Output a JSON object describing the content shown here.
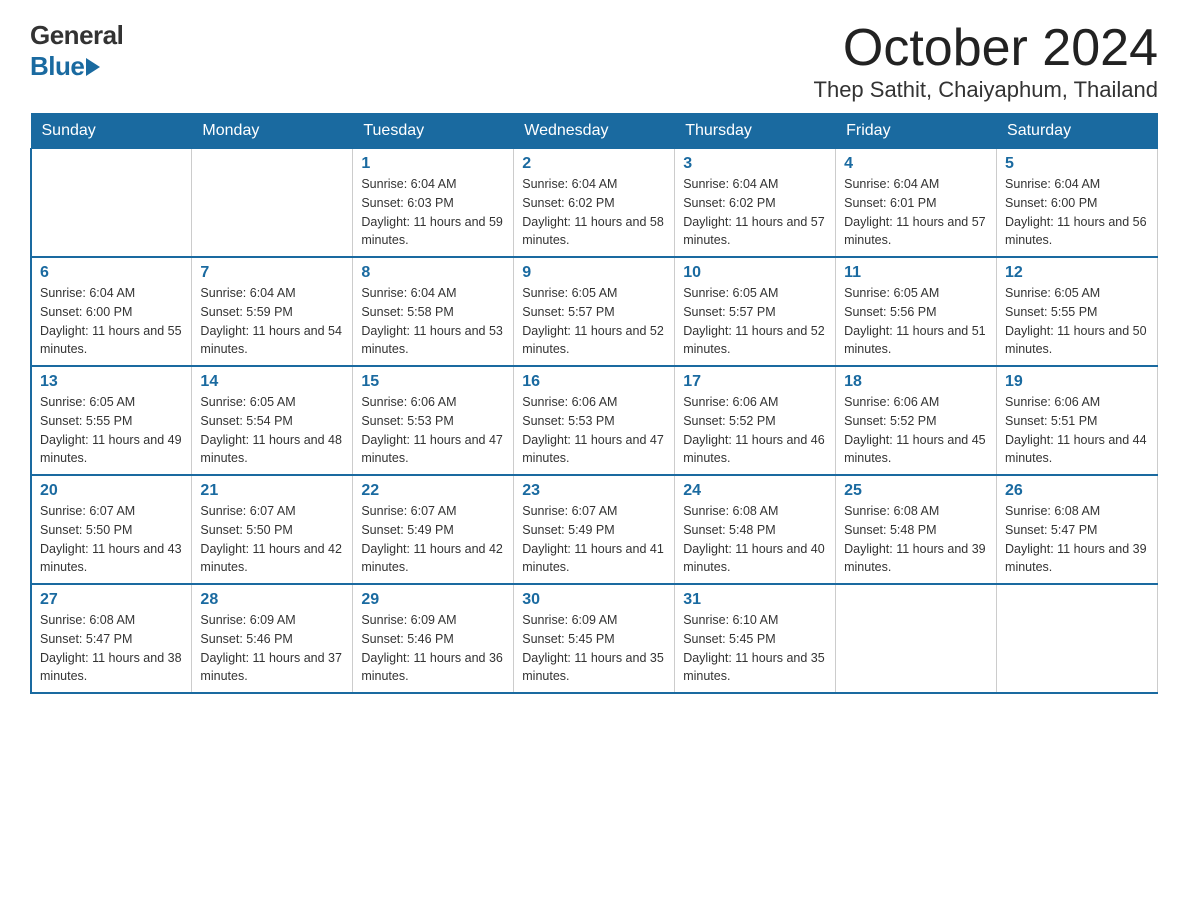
{
  "header": {
    "logo_general": "General",
    "logo_blue": "Blue",
    "month_title": "October 2024",
    "location": "Thep Sathit, Chaiyaphum, Thailand"
  },
  "weekdays": [
    "Sunday",
    "Monday",
    "Tuesday",
    "Wednesday",
    "Thursday",
    "Friday",
    "Saturday"
  ],
  "weeks": [
    [
      {
        "day": "",
        "sunrise": "",
        "sunset": "",
        "daylight": ""
      },
      {
        "day": "",
        "sunrise": "",
        "sunset": "",
        "daylight": ""
      },
      {
        "day": "1",
        "sunrise": "Sunrise: 6:04 AM",
        "sunset": "Sunset: 6:03 PM",
        "daylight": "Daylight: 11 hours and 59 minutes."
      },
      {
        "day": "2",
        "sunrise": "Sunrise: 6:04 AM",
        "sunset": "Sunset: 6:02 PM",
        "daylight": "Daylight: 11 hours and 58 minutes."
      },
      {
        "day": "3",
        "sunrise": "Sunrise: 6:04 AM",
        "sunset": "Sunset: 6:02 PM",
        "daylight": "Daylight: 11 hours and 57 minutes."
      },
      {
        "day": "4",
        "sunrise": "Sunrise: 6:04 AM",
        "sunset": "Sunset: 6:01 PM",
        "daylight": "Daylight: 11 hours and 57 minutes."
      },
      {
        "day": "5",
        "sunrise": "Sunrise: 6:04 AM",
        "sunset": "Sunset: 6:00 PM",
        "daylight": "Daylight: 11 hours and 56 minutes."
      }
    ],
    [
      {
        "day": "6",
        "sunrise": "Sunrise: 6:04 AM",
        "sunset": "Sunset: 6:00 PM",
        "daylight": "Daylight: 11 hours and 55 minutes."
      },
      {
        "day": "7",
        "sunrise": "Sunrise: 6:04 AM",
        "sunset": "Sunset: 5:59 PM",
        "daylight": "Daylight: 11 hours and 54 minutes."
      },
      {
        "day": "8",
        "sunrise": "Sunrise: 6:04 AM",
        "sunset": "Sunset: 5:58 PM",
        "daylight": "Daylight: 11 hours and 53 minutes."
      },
      {
        "day": "9",
        "sunrise": "Sunrise: 6:05 AM",
        "sunset": "Sunset: 5:57 PM",
        "daylight": "Daylight: 11 hours and 52 minutes."
      },
      {
        "day": "10",
        "sunrise": "Sunrise: 6:05 AM",
        "sunset": "Sunset: 5:57 PM",
        "daylight": "Daylight: 11 hours and 52 minutes."
      },
      {
        "day": "11",
        "sunrise": "Sunrise: 6:05 AM",
        "sunset": "Sunset: 5:56 PM",
        "daylight": "Daylight: 11 hours and 51 minutes."
      },
      {
        "day": "12",
        "sunrise": "Sunrise: 6:05 AM",
        "sunset": "Sunset: 5:55 PM",
        "daylight": "Daylight: 11 hours and 50 minutes."
      }
    ],
    [
      {
        "day": "13",
        "sunrise": "Sunrise: 6:05 AM",
        "sunset": "Sunset: 5:55 PM",
        "daylight": "Daylight: 11 hours and 49 minutes."
      },
      {
        "day": "14",
        "sunrise": "Sunrise: 6:05 AM",
        "sunset": "Sunset: 5:54 PM",
        "daylight": "Daylight: 11 hours and 48 minutes."
      },
      {
        "day": "15",
        "sunrise": "Sunrise: 6:06 AM",
        "sunset": "Sunset: 5:53 PM",
        "daylight": "Daylight: 11 hours and 47 minutes."
      },
      {
        "day": "16",
        "sunrise": "Sunrise: 6:06 AM",
        "sunset": "Sunset: 5:53 PM",
        "daylight": "Daylight: 11 hours and 47 minutes."
      },
      {
        "day": "17",
        "sunrise": "Sunrise: 6:06 AM",
        "sunset": "Sunset: 5:52 PM",
        "daylight": "Daylight: 11 hours and 46 minutes."
      },
      {
        "day": "18",
        "sunrise": "Sunrise: 6:06 AM",
        "sunset": "Sunset: 5:52 PM",
        "daylight": "Daylight: 11 hours and 45 minutes."
      },
      {
        "day": "19",
        "sunrise": "Sunrise: 6:06 AM",
        "sunset": "Sunset: 5:51 PM",
        "daylight": "Daylight: 11 hours and 44 minutes."
      }
    ],
    [
      {
        "day": "20",
        "sunrise": "Sunrise: 6:07 AM",
        "sunset": "Sunset: 5:50 PM",
        "daylight": "Daylight: 11 hours and 43 minutes."
      },
      {
        "day": "21",
        "sunrise": "Sunrise: 6:07 AM",
        "sunset": "Sunset: 5:50 PM",
        "daylight": "Daylight: 11 hours and 42 minutes."
      },
      {
        "day": "22",
        "sunrise": "Sunrise: 6:07 AM",
        "sunset": "Sunset: 5:49 PM",
        "daylight": "Daylight: 11 hours and 42 minutes."
      },
      {
        "day": "23",
        "sunrise": "Sunrise: 6:07 AM",
        "sunset": "Sunset: 5:49 PM",
        "daylight": "Daylight: 11 hours and 41 minutes."
      },
      {
        "day": "24",
        "sunrise": "Sunrise: 6:08 AM",
        "sunset": "Sunset: 5:48 PM",
        "daylight": "Daylight: 11 hours and 40 minutes."
      },
      {
        "day": "25",
        "sunrise": "Sunrise: 6:08 AM",
        "sunset": "Sunset: 5:48 PM",
        "daylight": "Daylight: 11 hours and 39 minutes."
      },
      {
        "day": "26",
        "sunrise": "Sunrise: 6:08 AM",
        "sunset": "Sunset: 5:47 PM",
        "daylight": "Daylight: 11 hours and 39 minutes."
      }
    ],
    [
      {
        "day": "27",
        "sunrise": "Sunrise: 6:08 AM",
        "sunset": "Sunset: 5:47 PM",
        "daylight": "Daylight: 11 hours and 38 minutes."
      },
      {
        "day": "28",
        "sunrise": "Sunrise: 6:09 AM",
        "sunset": "Sunset: 5:46 PM",
        "daylight": "Daylight: 11 hours and 37 minutes."
      },
      {
        "day": "29",
        "sunrise": "Sunrise: 6:09 AM",
        "sunset": "Sunset: 5:46 PM",
        "daylight": "Daylight: 11 hours and 36 minutes."
      },
      {
        "day": "30",
        "sunrise": "Sunrise: 6:09 AM",
        "sunset": "Sunset: 5:45 PM",
        "daylight": "Daylight: 11 hours and 35 minutes."
      },
      {
        "day": "31",
        "sunrise": "Sunrise: 6:10 AM",
        "sunset": "Sunset: 5:45 PM",
        "daylight": "Daylight: 11 hours and 35 minutes."
      },
      {
        "day": "",
        "sunrise": "",
        "sunset": "",
        "daylight": ""
      },
      {
        "day": "",
        "sunrise": "",
        "sunset": "",
        "daylight": ""
      }
    ]
  ]
}
